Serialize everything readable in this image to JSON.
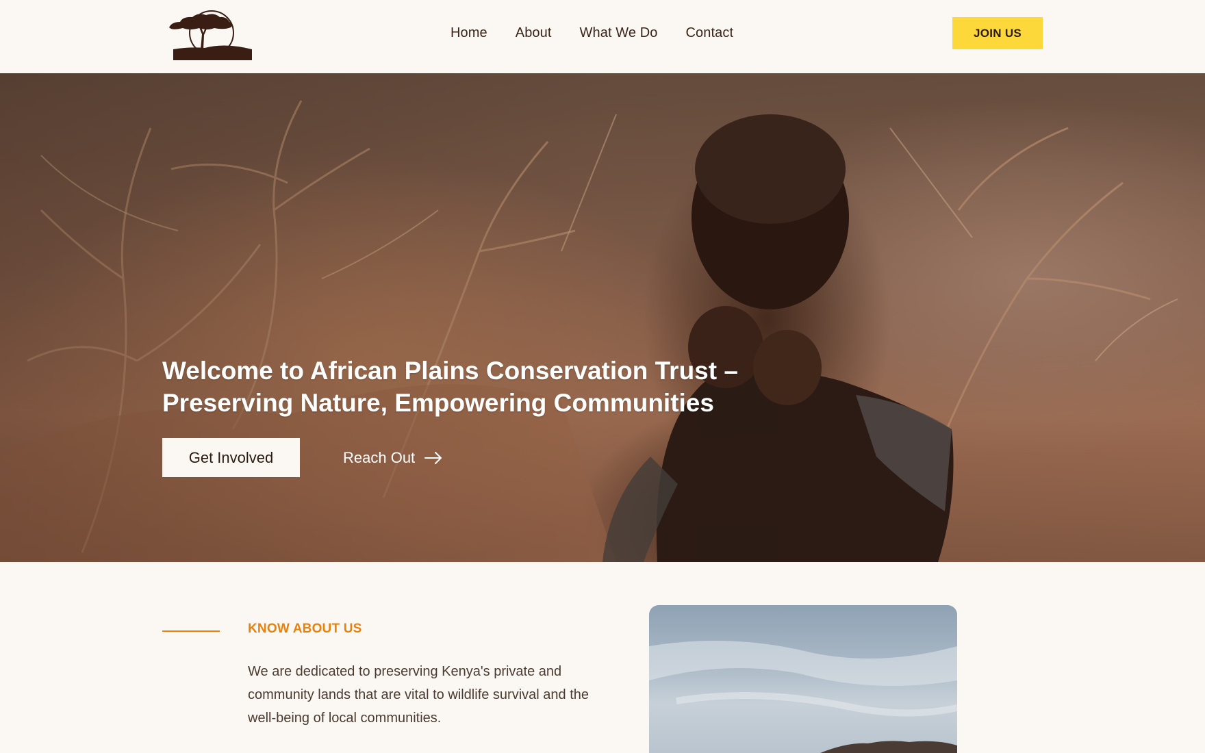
{
  "header": {
    "nav": [
      "Home",
      "About",
      "What We Do",
      "Contact"
    ],
    "join_label": "JOIN US"
  },
  "hero": {
    "title_line1": "Welcome to African Plains Conservation Trust –",
    "title_line2": "Preserving Nature, Empowering Communities",
    "primary_button": "Get Involved",
    "secondary_link": "Reach Out"
  },
  "about": {
    "eyebrow": "KNOW ABOUT US",
    "body": "We are dedicated to preserving Kenya's private and community lands that are vital to wildlife survival and the well-being of local communities."
  },
  "icons": {
    "logo": "acacia-tree-sun-logo",
    "reach_out_arrow": "arrow-right-icon"
  },
  "colors": {
    "background": "#fbf8f4",
    "accent_yellow": "#fdd83a",
    "accent_orange": "#e8820c",
    "text_dark": "#3a2418"
  }
}
